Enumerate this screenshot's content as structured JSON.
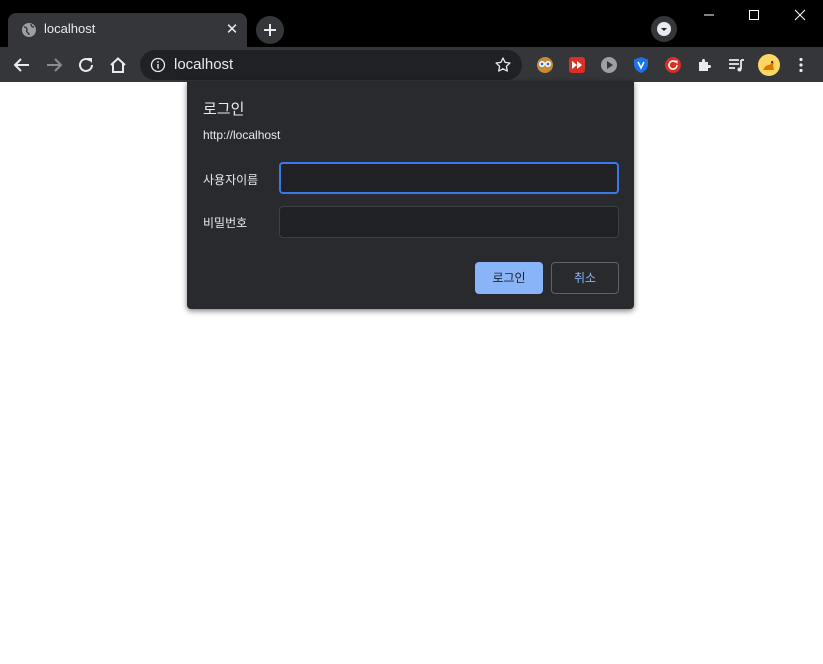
{
  "tab": {
    "title": "localhost",
    "close_glyph": "✕"
  },
  "omnibox": {
    "url": "localhost"
  },
  "dialog": {
    "title": "로그인",
    "origin": "http://localhost",
    "username_label": "사용자이름",
    "username_value": "",
    "password_label": "비밀번호",
    "password_value": "",
    "login_button": "로그인",
    "cancel_button": "취소"
  },
  "icons": {
    "favicon": "globe-icon",
    "new_tab": "plus-icon",
    "tab_search": "chevron-down-icon",
    "window": [
      "minimize-icon",
      "maximize-icon",
      "close-icon"
    ],
    "nav": [
      "back-arrow-icon",
      "forward-arrow-icon",
      "reload-icon",
      "home-icon"
    ],
    "omnibox": [
      "info-icon",
      "star-icon"
    ],
    "extensions": [
      "owl-extension-icon",
      "fast-forward-extension-icon",
      "play-extension-icon",
      "shield-extension-icon",
      "refresh-extension-icon",
      "puzzle-icon",
      "media-queue-icon",
      "profile-avatar-icon",
      "menu-kebab-icon"
    ]
  },
  "colors": {
    "accent": "#8ab4f8",
    "focus_ring": "#3b78e7",
    "dialog_bg": "#292a2d",
    "toolbar_bg": "#35363a"
  }
}
